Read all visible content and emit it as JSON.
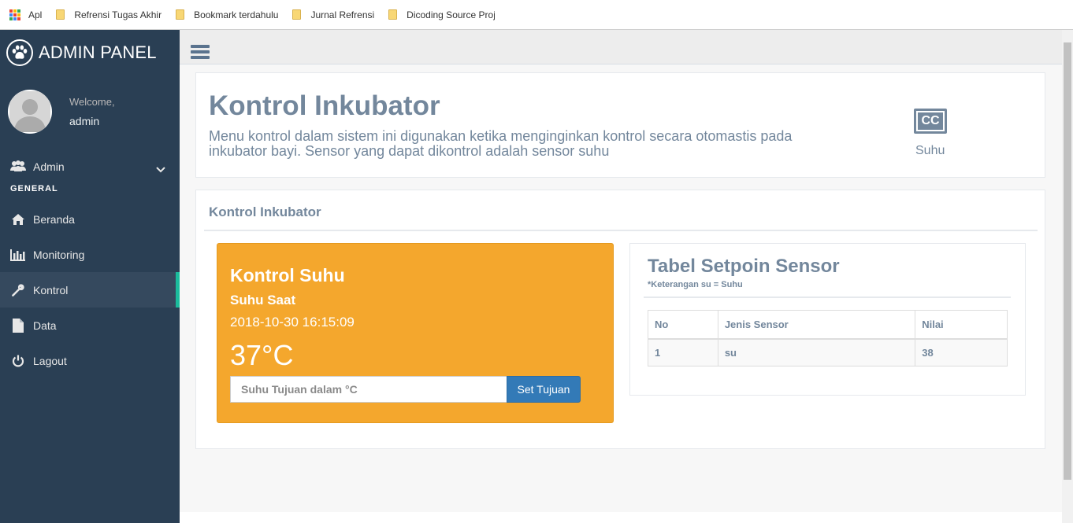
{
  "bookmarks": [
    {
      "label": "Apl",
      "type": "apps"
    },
    {
      "label": "Refrensi Tugas Akhir",
      "type": "folder"
    },
    {
      "label": "Bookmark terdahulu",
      "type": "folder"
    },
    {
      "label": "Jurnal Refrensi",
      "type": "folder"
    },
    {
      "label": "Dicoding Source Proj",
      "type": "folder"
    }
  ],
  "brand": {
    "title": "ADMIN PANEL",
    "icon": "paw-icon"
  },
  "profile": {
    "welcome": "Welcome,",
    "name": "admin"
  },
  "sidebar": {
    "admin_item": {
      "label": "Admin",
      "icon": "users-icon"
    },
    "section": "GENERAL",
    "items": [
      {
        "label": "Beranda",
        "icon": "home-icon"
      },
      {
        "label": "Monitoring",
        "icon": "bar-chart-icon"
      },
      {
        "label": "Kontrol",
        "icon": "wrench-icon",
        "active": true
      },
      {
        "label": "Data",
        "icon": "file-icon"
      },
      {
        "label": "Lagout",
        "icon": "power-icon"
      }
    ]
  },
  "header": {
    "title": "Kontrol Inkubator",
    "description": "Menu kontrol dalam sistem ini digunakan ketika menginginkan kontrol secara otomastis pada inkubator bayi. Sensor yang dapat dikontrol adalah sensor suhu",
    "badge_icon_text": "CC",
    "badge_label": "Suhu"
  },
  "main": {
    "panel_title": "Kontrol Inkubator",
    "control": {
      "title": "Kontrol Suhu",
      "subtitle": "Suhu Saat",
      "timestamp": "2018-10-30 16:15:09",
      "temperature": "37°C",
      "input_placeholder": "Suhu Tujuan dalam °C",
      "button_label": "Set Tujuan"
    },
    "table": {
      "title": "Tabel Setpoin Sensor",
      "note": "*Keterangan su = Suhu",
      "headers": {
        "no": "No",
        "jenis": "Jenis Sensor",
        "nilai": "Nilai"
      },
      "rows": [
        {
          "no": "1",
          "jenis": "su",
          "nilai": "38"
        }
      ]
    }
  },
  "colors": {
    "sidebar_bg": "#2a3f54",
    "accent_active": "#1abb9c",
    "orange_card": "#f4a72d",
    "primary_button": "#337ab7",
    "text_muted": "#73879c"
  }
}
